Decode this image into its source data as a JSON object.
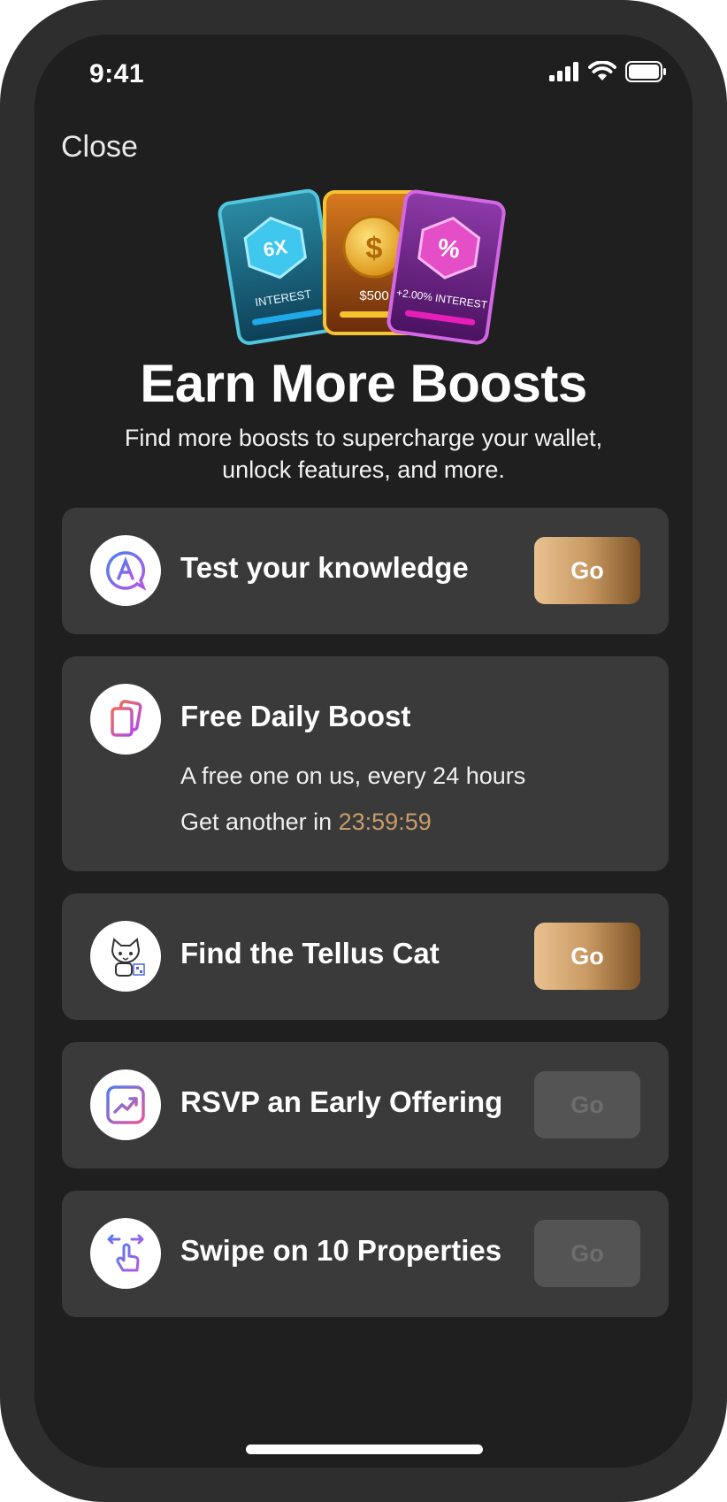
{
  "status_bar": {
    "time": "9:41"
  },
  "header": {
    "close_label": "Close"
  },
  "hero": {
    "cards": [
      {
        "badge": "6X",
        "caption": "INTEREST"
      },
      {
        "badge": "$",
        "caption": "$500"
      },
      {
        "badge": "%",
        "caption": "+2.00% INTEREST"
      }
    ],
    "title": "Earn More Boosts",
    "subtitle": "Find more boosts to supercharge your wallet, unlock features, and more."
  },
  "tasks": [
    {
      "label": "Test your knowledge",
      "button": "Go",
      "enabled": true,
      "icon": "quiz-icon"
    },
    {
      "label": "Free Daily Boost",
      "description": "A free one on us, every 24 hours",
      "timer_prefix": "Get another in ",
      "timer": "23:59:59",
      "icon": "cards-icon"
    },
    {
      "label": "Find the Tellus Cat",
      "button": "Go",
      "enabled": true,
      "icon": "cat-icon"
    },
    {
      "label": "RSVP an Early Offering",
      "button": "Go",
      "enabled": false,
      "icon": "chart-icon"
    },
    {
      "label": "Swipe on 10 Properties",
      "button": "Go",
      "enabled": false,
      "icon": "swipe-hand-icon"
    }
  ],
  "colors": {
    "background": "#1f1f1f",
    "card": "#3a3a3a",
    "accent_gold": "#c79d6a",
    "disabled_button": "#545454"
  }
}
